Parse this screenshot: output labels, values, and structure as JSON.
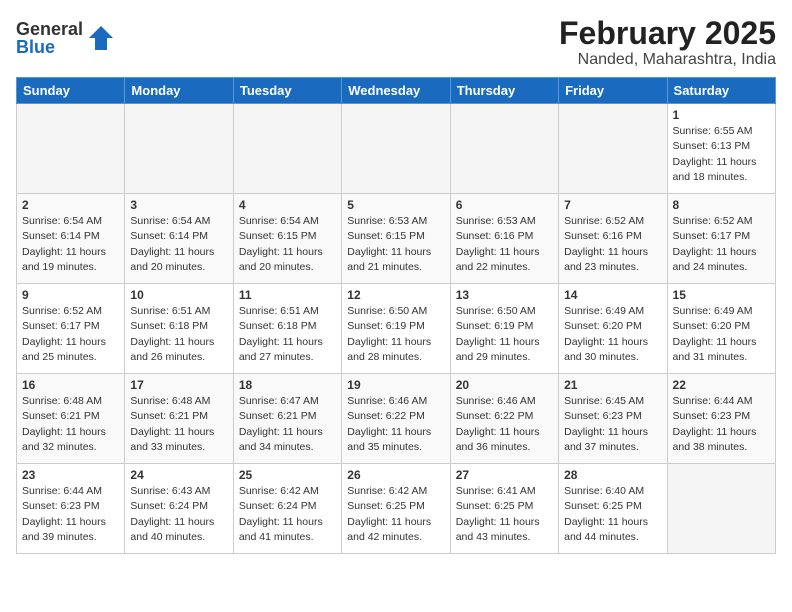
{
  "logo": {
    "general": "General",
    "blue": "Blue"
  },
  "title": "February 2025",
  "subtitle": "Nanded, Maharashtra, India",
  "weekdays": [
    "Sunday",
    "Monday",
    "Tuesday",
    "Wednesday",
    "Thursday",
    "Friday",
    "Saturday"
  ],
  "weeks": [
    [
      {
        "day": "",
        "empty": true
      },
      {
        "day": "",
        "empty": true
      },
      {
        "day": "",
        "empty": true
      },
      {
        "day": "",
        "empty": true
      },
      {
        "day": "",
        "empty": true
      },
      {
        "day": "",
        "empty": true
      },
      {
        "day": "1",
        "sunrise": "6:55 AM",
        "sunset": "6:13 PM",
        "daylight": "11 hours and 18 minutes."
      }
    ],
    [
      {
        "day": "2",
        "sunrise": "6:54 AM",
        "sunset": "6:14 PM",
        "daylight": "11 hours and 19 minutes."
      },
      {
        "day": "3",
        "sunrise": "6:54 AM",
        "sunset": "6:14 PM",
        "daylight": "11 hours and 20 minutes."
      },
      {
        "day": "4",
        "sunrise": "6:54 AM",
        "sunset": "6:15 PM",
        "daylight": "11 hours and 20 minutes."
      },
      {
        "day": "5",
        "sunrise": "6:53 AM",
        "sunset": "6:15 PM",
        "daylight": "11 hours and 21 minutes."
      },
      {
        "day": "6",
        "sunrise": "6:53 AM",
        "sunset": "6:16 PM",
        "daylight": "11 hours and 22 minutes."
      },
      {
        "day": "7",
        "sunrise": "6:52 AM",
        "sunset": "6:16 PM",
        "daylight": "11 hours and 23 minutes."
      },
      {
        "day": "8",
        "sunrise": "6:52 AM",
        "sunset": "6:17 PM",
        "daylight": "11 hours and 24 minutes."
      }
    ],
    [
      {
        "day": "9",
        "sunrise": "6:52 AM",
        "sunset": "6:17 PM",
        "daylight": "11 hours and 25 minutes."
      },
      {
        "day": "10",
        "sunrise": "6:51 AM",
        "sunset": "6:18 PM",
        "daylight": "11 hours and 26 minutes."
      },
      {
        "day": "11",
        "sunrise": "6:51 AM",
        "sunset": "6:18 PM",
        "daylight": "11 hours and 27 minutes."
      },
      {
        "day": "12",
        "sunrise": "6:50 AM",
        "sunset": "6:19 PM",
        "daylight": "11 hours and 28 minutes."
      },
      {
        "day": "13",
        "sunrise": "6:50 AM",
        "sunset": "6:19 PM",
        "daylight": "11 hours and 29 minutes."
      },
      {
        "day": "14",
        "sunrise": "6:49 AM",
        "sunset": "6:20 PM",
        "daylight": "11 hours and 30 minutes."
      },
      {
        "day": "15",
        "sunrise": "6:49 AM",
        "sunset": "6:20 PM",
        "daylight": "11 hours and 31 minutes."
      }
    ],
    [
      {
        "day": "16",
        "sunrise": "6:48 AM",
        "sunset": "6:21 PM",
        "daylight": "11 hours and 32 minutes."
      },
      {
        "day": "17",
        "sunrise": "6:48 AM",
        "sunset": "6:21 PM",
        "daylight": "11 hours and 33 minutes."
      },
      {
        "day": "18",
        "sunrise": "6:47 AM",
        "sunset": "6:21 PM",
        "daylight": "11 hours and 34 minutes."
      },
      {
        "day": "19",
        "sunrise": "6:46 AM",
        "sunset": "6:22 PM",
        "daylight": "11 hours and 35 minutes."
      },
      {
        "day": "20",
        "sunrise": "6:46 AM",
        "sunset": "6:22 PM",
        "daylight": "11 hours and 36 minutes."
      },
      {
        "day": "21",
        "sunrise": "6:45 AM",
        "sunset": "6:23 PM",
        "daylight": "11 hours and 37 minutes."
      },
      {
        "day": "22",
        "sunrise": "6:44 AM",
        "sunset": "6:23 PM",
        "daylight": "11 hours and 38 minutes."
      }
    ],
    [
      {
        "day": "23",
        "sunrise": "6:44 AM",
        "sunset": "6:23 PM",
        "daylight": "11 hours and 39 minutes."
      },
      {
        "day": "24",
        "sunrise": "6:43 AM",
        "sunset": "6:24 PM",
        "daylight": "11 hours and 40 minutes."
      },
      {
        "day": "25",
        "sunrise": "6:42 AM",
        "sunset": "6:24 PM",
        "daylight": "11 hours and 41 minutes."
      },
      {
        "day": "26",
        "sunrise": "6:42 AM",
        "sunset": "6:25 PM",
        "daylight": "11 hours and 42 minutes."
      },
      {
        "day": "27",
        "sunrise": "6:41 AM",
        "sunset": "6:25 PM",
        "daylight": "11 hours and 43 minutes."
      },
      {
        "day": "28",
        "sunrise": "6:40 AM",
        "sunset": "6:25 PM",
        "daylight": "11 hours and 44 minutes."
      },
      {
        "day": "",
        "empty": true
      }
    ]
  ]
}
